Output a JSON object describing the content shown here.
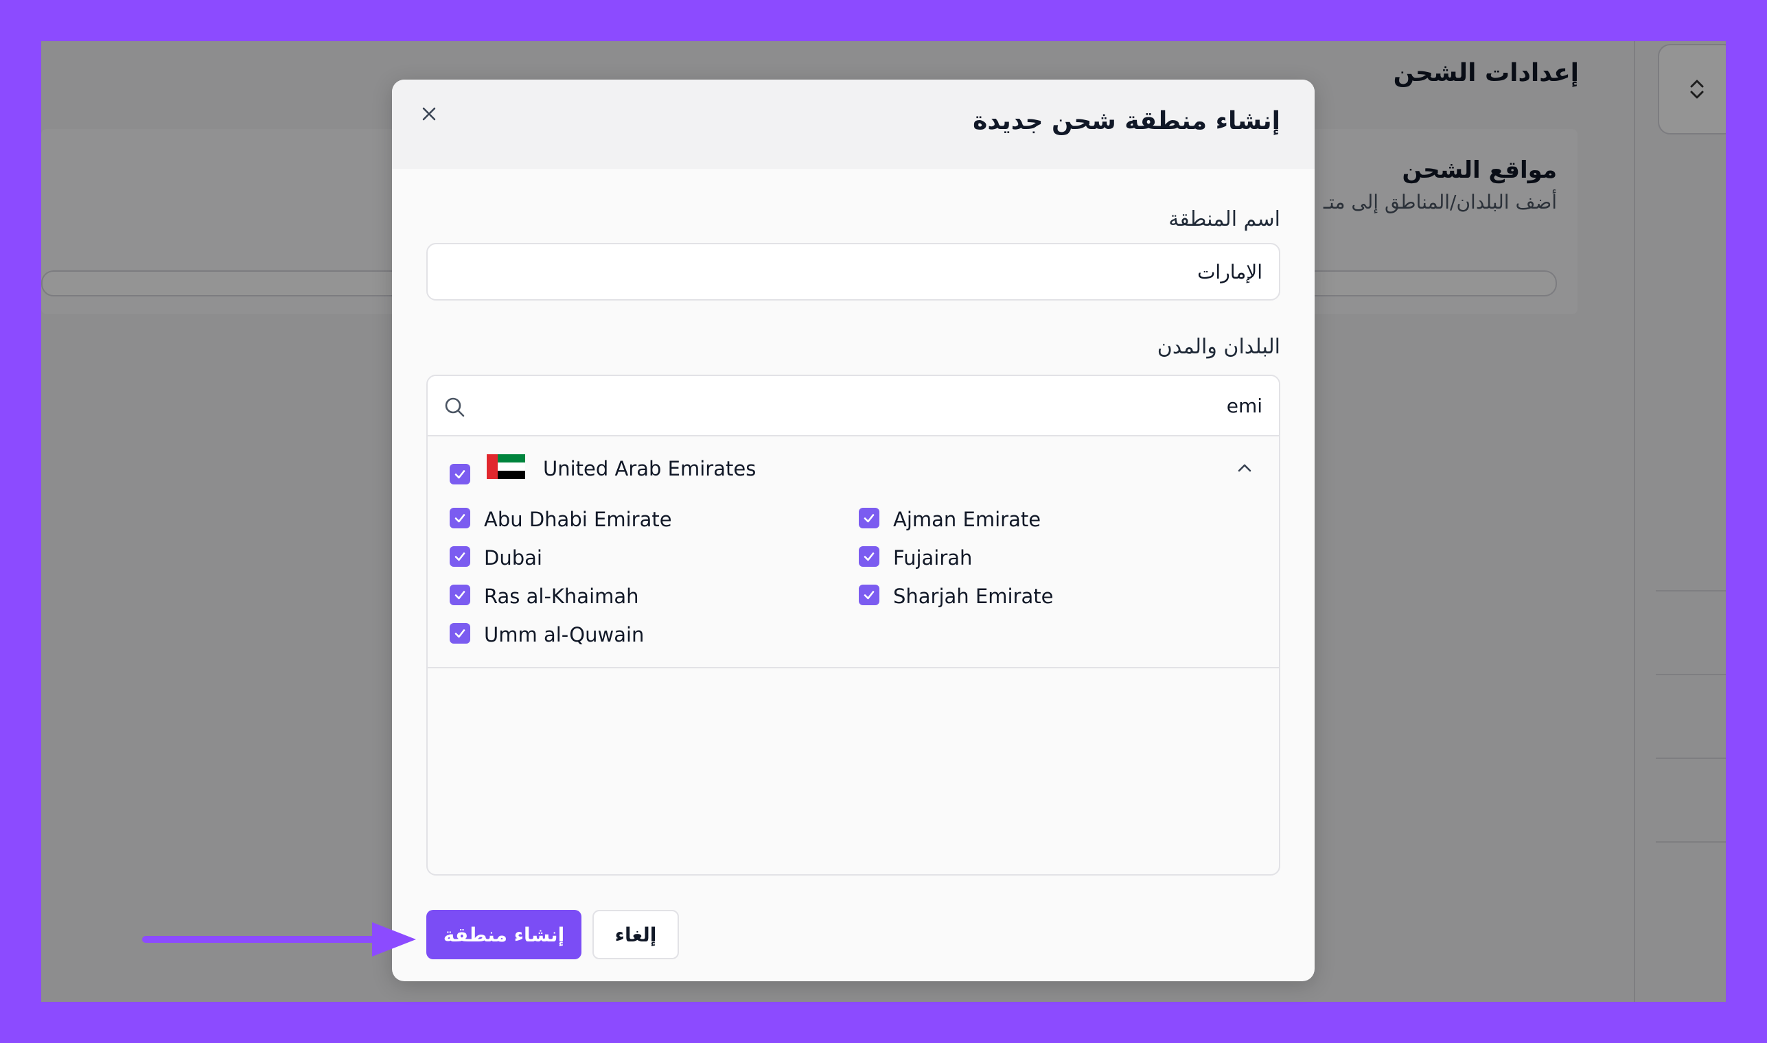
{
  "background_page": {
    "title": "إعدادات الشحن",
    "section_title": "مواقع الشحن",
    "section_subtitle": "أضف البلدان/المناطق إلى متـ"
  },
  "modal": {
    "title": "إنشاء منطقة شحن جديدة",
    "zone_name": {
      "label": "اسم المنطقة",
      "value": "الإمارات"
    },
    "countries": {
      "label": "البلدان والمدن",
      "search_value": "emi",
      "country": {
        "name": "United Arab Emirates",
        "checked": true,
        "expanded": true,
        "regions": [
          {
            "name": "Abu Dhabi Emirate",
            "checked": true
          },
          {
            "name": "Ajman Emirate",
            "checked": true
          },
          {
            "name": "Dubai",
            "checked": true
          },
          {
            "name": "Fujairah",
            "checked": true
          },
          {
            "name": "Ras al-Khaimah",
            "checked": true
          },
          {
            "name": "Sharjah Emirate",
            "checked": true
          },
          {
            "name": "Umm al-Quwain",
            "checked": true
          }
        ]
      }
    },
    "buttons": {
      "create": "إنشاء منطقة",
      "cancel": "إلغاء"
    }
  },
  "colors": {
    "frame": "#8c4bff",
    "primary": "#7b4df5",
    "checkbox": "#7b5cf0"
  }
}
